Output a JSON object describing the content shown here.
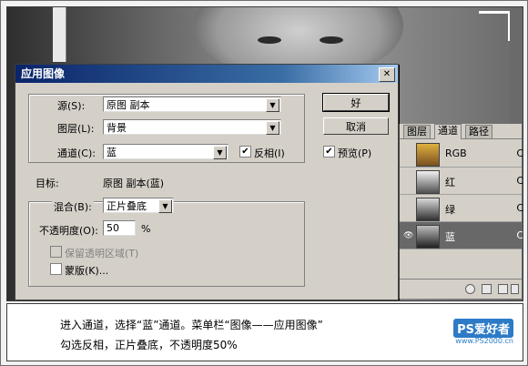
{
  "dialog": {
    "title": "应用图像",
    "source_label": "源(S):",
    "source_value": "原图 副本",
    "layer_label": "图层(L):",
    "layer_value": "背景",
    "channel_label": "通道(C):",
    "channel_value": "蓝",
    "invert_label": "反相(I)",
    "invert_checked": true,
    "target_label": "目标:",
    "target_value": "原图 副本(蓝)",
    "blend_label": "混合(B):",
    "blend_value": "正片叠底",
    "opacity_label": "不透明度(O):",
    "opacity_value": "50",
    "opacity_unit": "%",
    "preserve_label": "保留透明区域(T)",
    "mask_label": "蒙版(K)...",
    "ok_label": "好",
    "cancel_label": "取消",
    "preview_label": "预览(P)",
    "preview_checked": true
  },
  "channels_panel": {
    "tabs": [
      "图层",
      "通道",
      "路径"
    ],
    "active_tab": "通道",
    "rows": [
      {
        "name": "RGB",
        "shortcut": "C",
        "selected": false
      },
      {
        "name": "红",
        "shortcut": "C",
        "selected": false
      },
      {
        "name": "绿",
        "shortcut": "C",
        "selected": false
      },
      {
        "name": "蓝",
        "shortcut": "C",
        "selected": true
      }
    ]
  },
  "caption": {
    "line1": "进入通道，选择“蓝”通道。菜单栏“图像——应用图像”",
    "line2": "勾选反相，正片叠底，不透明度50%",
    "logo_main": "PS爱好者",
    "logo_url": "www.PS2000.cn"
  },
  "colors": {
    "titlebar": "#0a246a",
    "dialog_bg": "#d4d0c8",
    "selected_row": "#686868",
    "logo_blue": "#2d7bc7"
  }
}
